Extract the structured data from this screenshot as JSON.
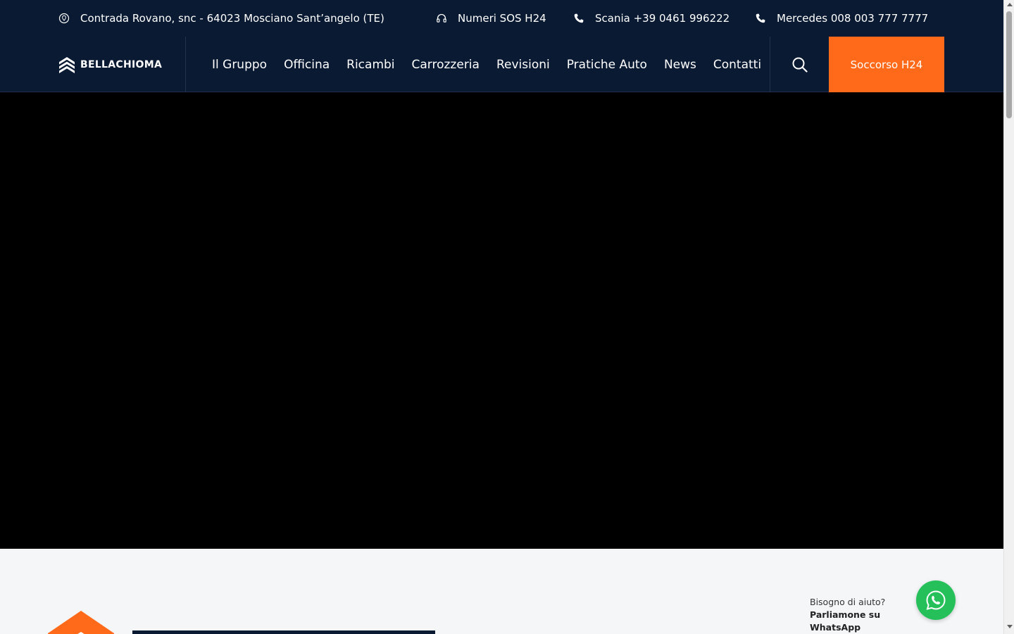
{
  "topbar": {
    "address": {
      "icon": "location-pin-icon",
      "text": "Contrada Rovano, snc - 64023 Mosciano Sant’angelo (TE)"
    },
    "sos": {
      "icon": "headset-icon",
      "text": "Numeri SOS H24"
    },
    "scania": {
      "icon": "phone-icon",
      "text": "Scania +39 0461 996222"
    },
    "mercedes": {
      "icon": "phone-icon",
      "text": "Mercedes 008 003 777 7777"
    }
  },
  "brand": {
    "name": "BELLACHIOMA",
    "logo_icon": "bellachioma-logo-icon"
  },
  "nav": {
    "items": [
      "Il Gruppo",
      "Officina",
      "Ricambi",
      "Carrozzeria",
      "Revisioni",
      "Pratiche Auto",
      "News",
      "Contatti"
    ],
    "search_icon": "search-icon",
    "cta_label": "Soccorso H24"
  },
  "whatsapp": {
    "title": "Bisogno di aiuto?",
    "cta": "Parliamone su WhatsApp",
    "icon": "whatsapp-icon"
  },
  "colors": {
    "header_bg": "#0a1a33",
    "accent": "#ff6a1a",
    "hero_bg": "#000000",
    "whatsapp": "#25c05a"
  }
}
